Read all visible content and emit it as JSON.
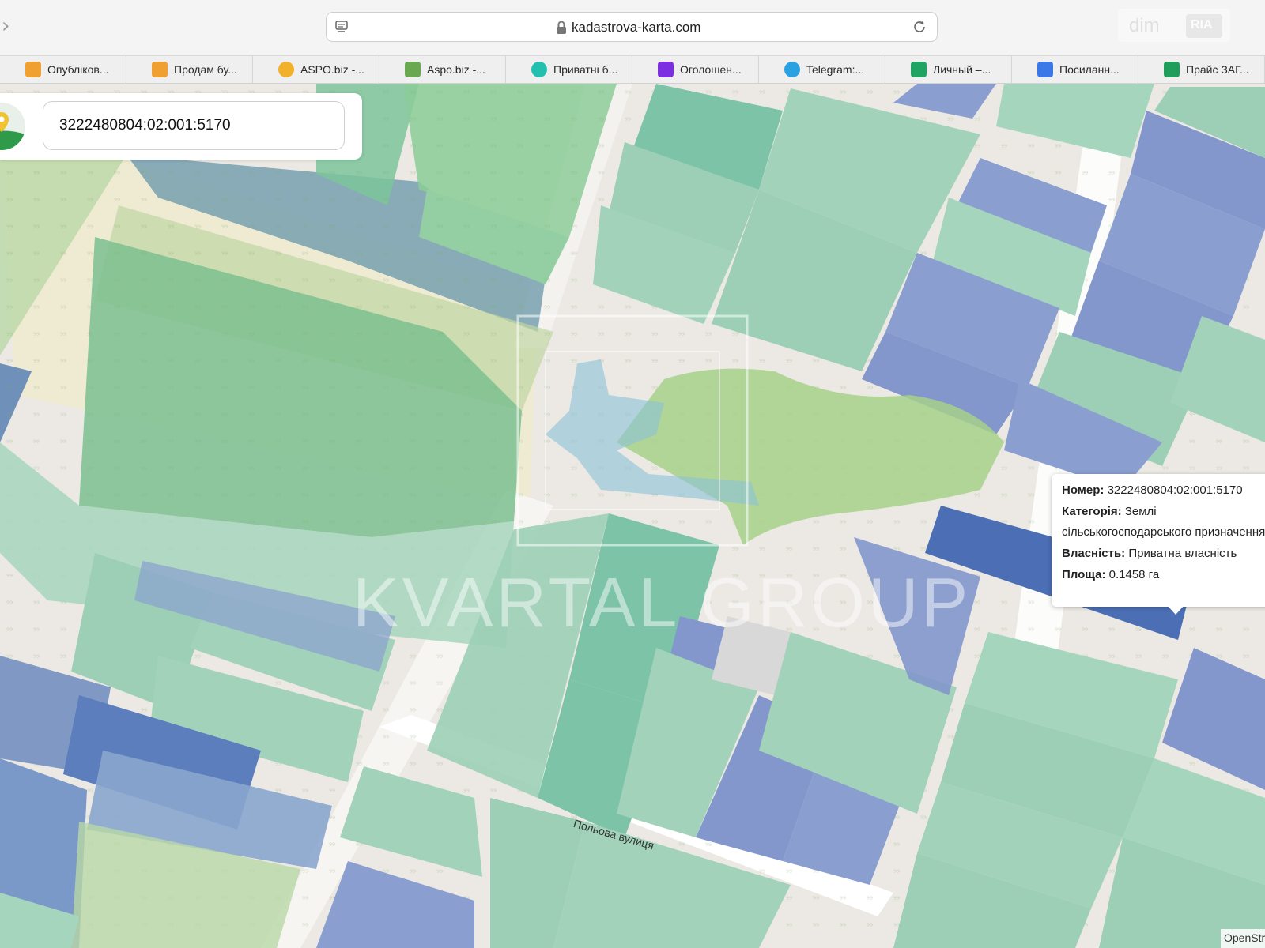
{
  "browser": {
    "url": "kadastrova-karta.com",
    "extension_label": "dim",
    "extension_badge": "RIA",
    "forward_glyph": "›"
  },
  "bookmarks": [
    {
      "label": "Опубліков...",
      "icon": "check-badge-icon",
      "color": "#f0a030"
    },
    {
      "label": "Продам бу...",
      "icon": "check-badge-icon",
      "color": "#f0a030"
    },
    {
      "label": "ASPO.biz -...",
      "icon": "aspo-icon",
      "color": "#f2b12b"
    },
    {
      "label": "Aspo.biz -...",
      "icon": "envelope-icon",
      "color": "#6aa84f"
    },
    {
      "label": "Приватні б...",
      "icon": "olx-icon",
      "color": "#23c0b0"
    },
    {
      "label": "Оголошен...",
      "icon": "key-icon",
      "color": "#7b2fe0"
    },
    {
      "label": "Telegram:...",
      "icon": "telegram-icon",
      "color": "#2aa1e0"
    },
    {
      "label": "Личный –...",
      "icon": "google-drive-icon",
      "color": "#1fa463"
    },
    {
      "label": "Посиланн...",
      "icon": "google-docs-icon",
      "color": "#3b78e7"
    },
    {
      "label": "Прайс ЗАГ...",
      "icon": "google-sheets-icon",
      "color": "#1e9e5a"
    }
  ],
  "search": {
    "value": "3222480804:02:001:5170"
  },
  "popup": {
    "number_label": "Номер:",
    "number_value": "3222480804:02:001:5170",
    "category_label": "Категорія:",
    "category_value_1": "Землі",
    "category_value_2": "сільськогосподарського призначення",
    "ownership_label": "Власність:",
    "ownership_value": "Приватна власність",
    "area_label": "Площа:",
    "area_value": "0.1458 га"
  },
  "map": {
    "street_label": "Польова вулиця",
    "attribution": "OpenStreetMap",
    "watermark": "KVARTAL GROUP",
    "colors": {
      "background": "#ece9e4",
      "parcel_green": "#9ccfb6",
      "parcel_blue": "#8a9fcf",
      "selected_parcel": "#4b6eb4",
      "forest": "#a7d08a"
    }
  }
}
